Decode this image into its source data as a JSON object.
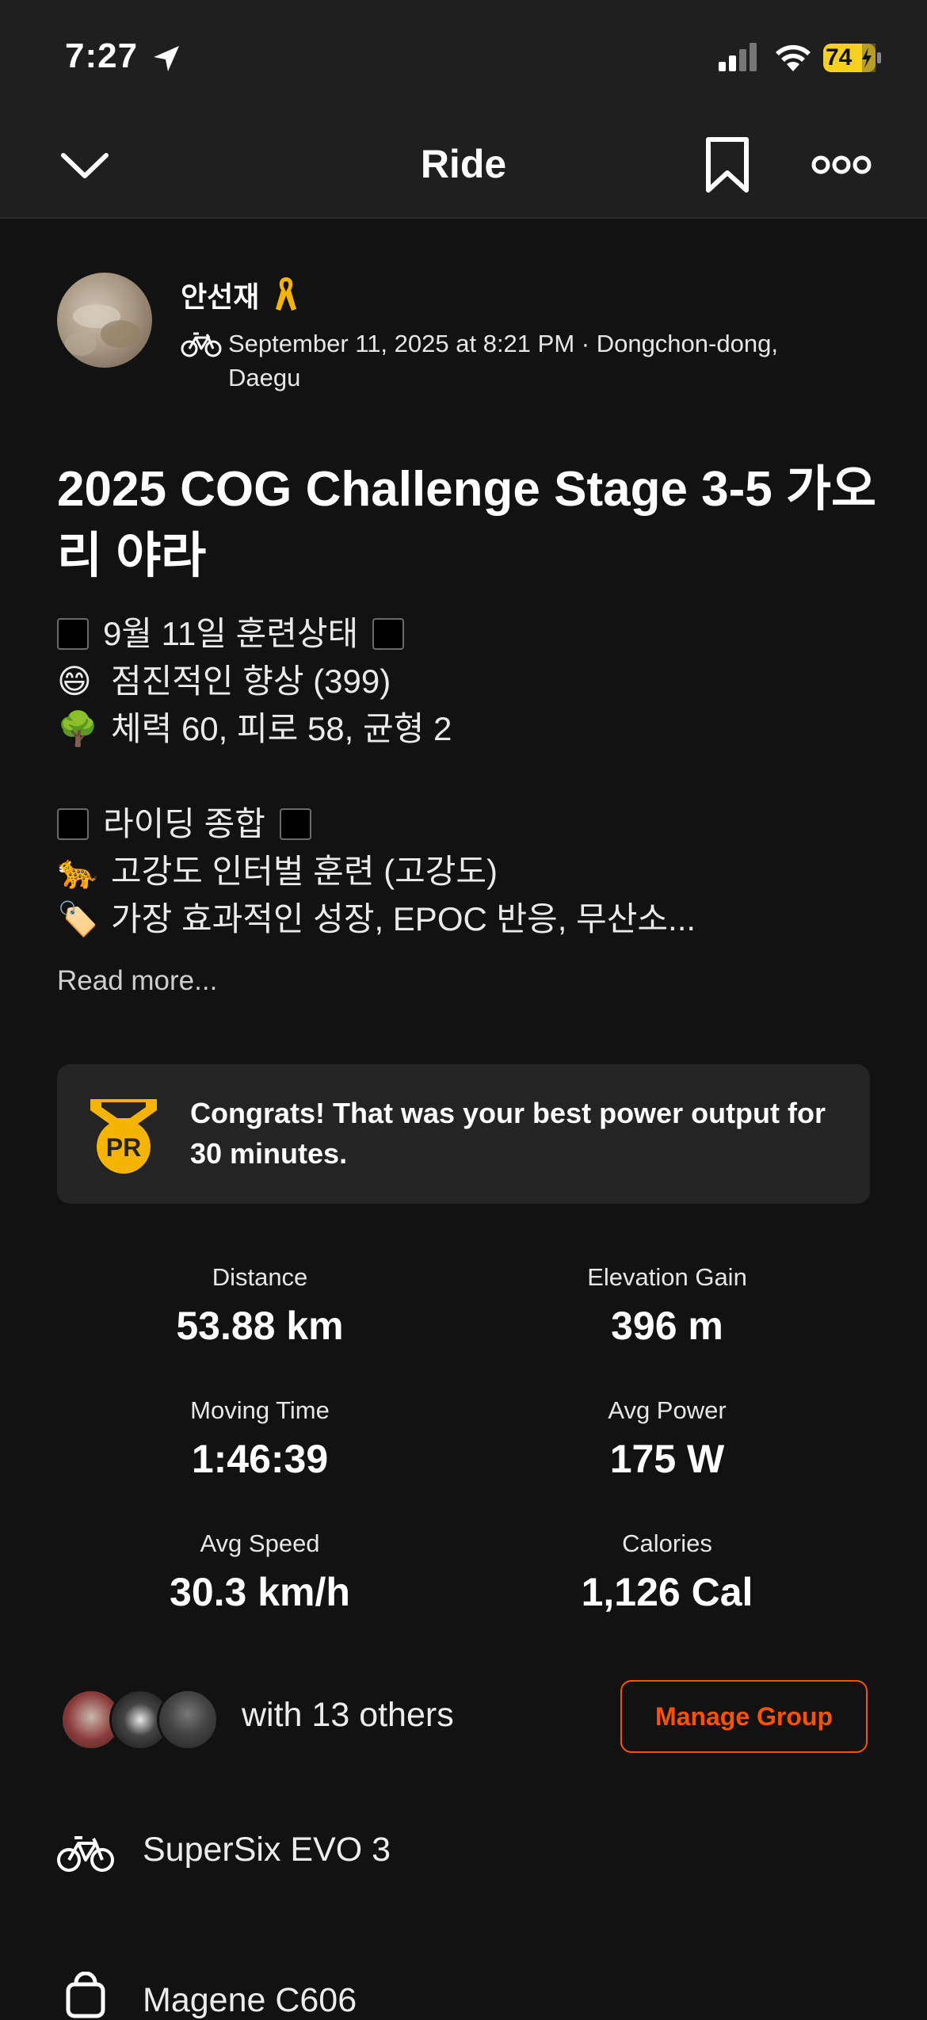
{
  "status_bar": {
    "time": "7:27",
    "battery": "74"
  },
  "nav": {
    "title": "Ride"
  },
  "header": {
    "athlete_name": "안선재",
    "meta_line": "September 11, 2025 at 8:21 PM · Dongchon-dong, Daegu"
  },
  "activity": {
    "title": "2025 COG Challenge Stage 3-5 가오리 야라",
    "description": {
      "line1": "9월 11일 훈련상태",
      "line2_emoji": "😄",
      "line2": "점진적인 향상 (399)",
      "line3_emoji": "🌳",
      "line3": "체력 60, 피로 58, 균형 2",
      "line4": "라이딩 종합",
      "line5_emoji": "🐆",
      "line5": "고강도 인터벌 훈련 (고강도)",
      "line6_emoji": "🏷️",
      "line6": "가장 효과적인 성장, EPOC 반응, 무산소..."
    },
    "read_more": "Read more..."
  },
  "pr_card": {
    "badge": "PR",
    "text": "Congrats! That was your best power output for 30 minutes."
  },
  "stats": [
    {
      "label": "Distance",
      "value": "53.88 km"
    },
    {
      "label": "Elevation Gain",
      "value": "396 m"
    },
    {
      "label": "Moving Time",
      "value": "1:46:39"
    },
    {
      "label": "Avg Power",
      "value": "175 W"
    },
    {
      "label": "Avg Speed",
      "value": "30.3 km/h"
    },
    {
      "label": "Calories",
      "value": "1,126 Cal"
    }
  ],
  "group": {
    "with_text": "with 13 others",
    "manage_label": "Manage Group"
  },
  "gear": {
    "bike": "SuperSix EVO 3",
    "device": "Magene C606"
  },
  "colors": {
    "accent": "#fc5200",
    "pr_gold": "#f5b400",
    "battery": "#f7d11e"
  }
}
